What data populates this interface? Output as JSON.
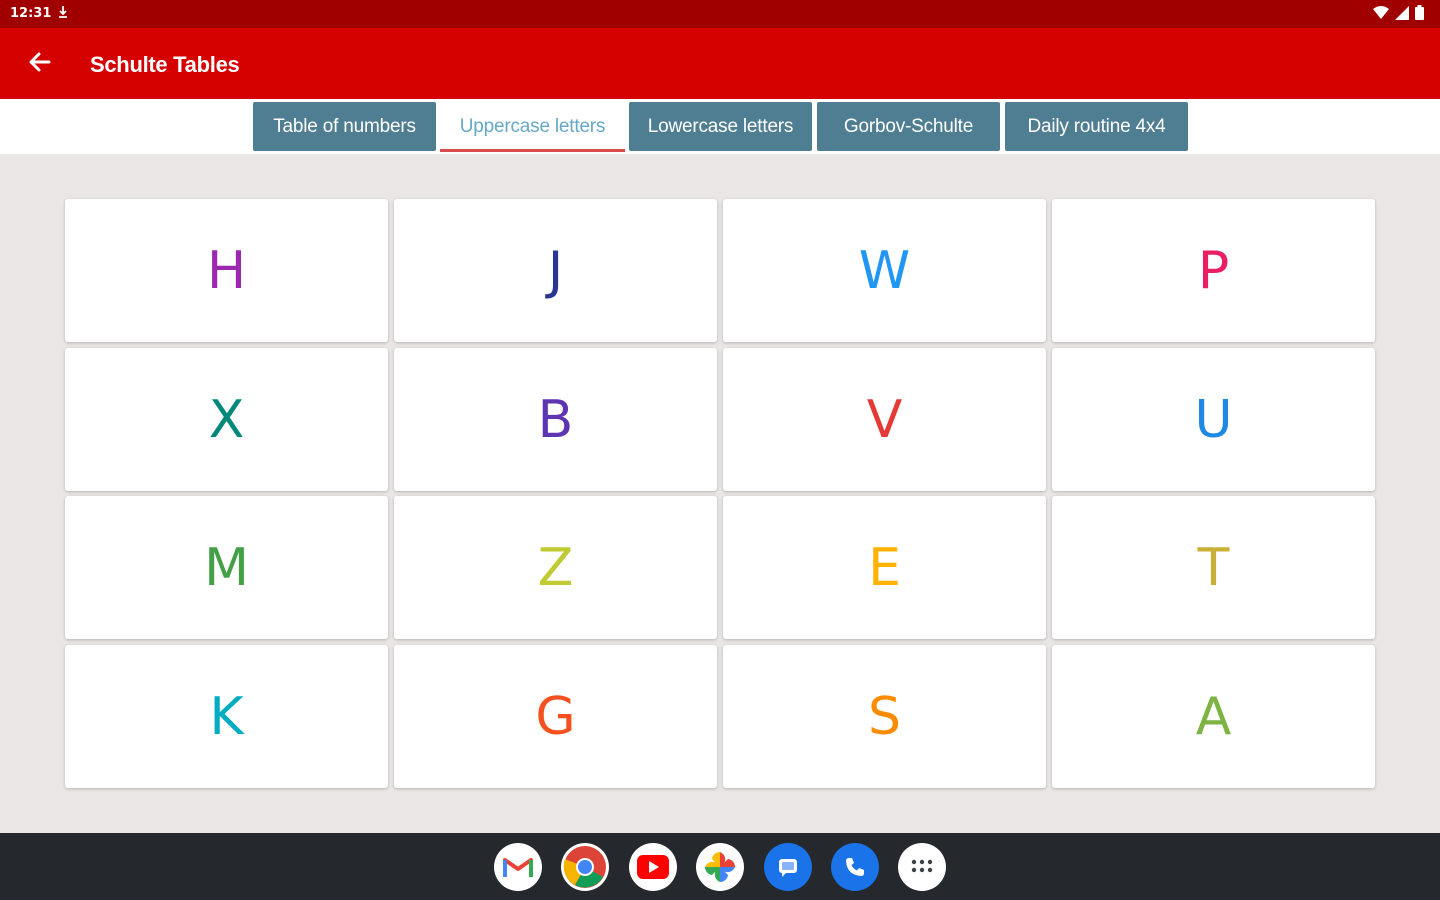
{
  "status_bar": {
    "time": "12:31",
    "notification_icon": "download-icon",
    "right_icons": [
      "wifi-icon",
      "signal-icon",
      "battery-icon"
    ]
  },
  "app_bar": {
    "title": "Schulte Tables",
    "back_icon": "arrow-back-icon",
    "background": "#d50000"
  },
  "tabs": [
    {
      "label": "Table of numbers",
      "active": false
    },
    {
      "label": "Uppercase letters",
      "active": true
    },
    {
      "label": "Lowercase letters",
      "active": false
    },
    {
      "label": "Gorbov-Schulte",
      "active": false
    },
    {
      "label": "Daily routine 4x4",
      "active": false
    }
  ],
  "grid": {
    "rows": 4,
    "cols": 4,
    "cells": [
      {
        "letter": "H",
        "color": "#9c27b0"
      },
      {
        "letter": "J",
        "color": "#283593"
      },
      {
        "letter": "W",
        "color": "#2196f3"
      },
      {
        "letter": "P",
        "color": "#e91e63"
      },
      {
        "letter": "X",
        "color": "#00897b"
      },
      {
        "letter": "B",
        "color": "#5e35b1"
      },
      {
        "letter": "V",
        "color": "#e53935"
      },
      {
        "letter": "U",
        "color": "#1e88e5"
      },
      {
        "letter": "M",
        "color": "#43a047"
      },
      {
        "letter": "Z",
        "color": "#c0ca33"
      },
      {
        "letter": "E",
        "color": "#ffb300"
      },
      {
        "letter": "T",
        "color": "#c9b037"
      },
      {
        "letter": "K",
        "color": "#00acc1"
      },
      {
        "letter": "G",
        "color": "#f4511e"
      },
      {
        "letter": "S",
        "color": "#fb8c00"
      },
      {
        "letter": "A",
        "color": "#7cb342"
      }
    ]
  },
  "dock": [
    {
      "name": "gmail-icon"
    },
    {
      "name": "chrome-icon"
    },
    {
      "name": "youtube-icon"
    },
    {
      "name": "photos-icon"
    },
    {
      "name": "messages-icon"
    },
    {
      "name": "phone-icon"
    },
    {
      "name": "app-drawer-icon"
    }
  ]
}
